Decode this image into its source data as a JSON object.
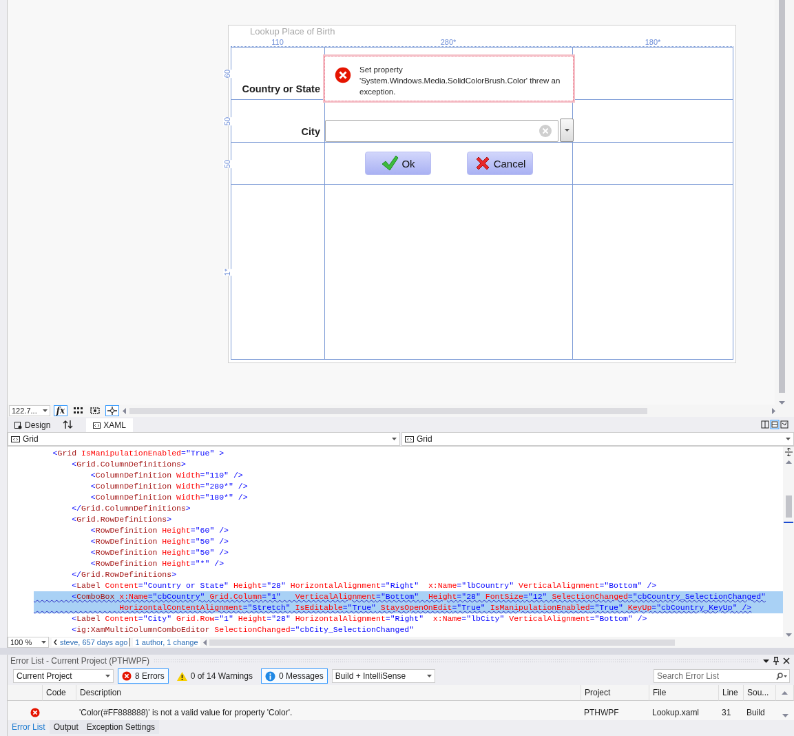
{
  "designer": {
    "window": {
      "title": "Lookup Place of Birth"
    },
    "columns": [
      {
        "label": "110"
      },
      {
        "label": "280*"
      },
      {
        "label": "180*"
      }
    ],
    "rows": [
      {
        "label": "60"
      },
      {
        "label": "50"
      },
      {
        "label": "50"
      },
      {
        "label": "1*"
      }
    ],
    "error_popup": {
      "text": "Set property 'System.Windows.Media.SolidColorBrush.Color' threw an exception."
    },
    "country_label": "Country or State",
    "city_label": "City",
    "buttons": [
      {
        "label": "Ok",
        "kind": "ok"
      },
      {
        "label": "Cancel",
        "kind": "cancel"
      }
    ]
  },
  "designer_toolbar": {
    "zoom": "122.7...",
    "buttons": [
      {
        "kind": "formula",
        "label": "fx",
        "selected": true
      },
      {
        "kind": "grid",
        "selected": false
      },
      {
        "kind": "effects",
        "selected": false
      },
      {
        "kind": "snap",
        "selected": true
      }
    ]
  },
  "view_tabs": [
    {
      "label": "Design",
      "selected": false
    },
    {
      "label": "XAML",
      "selected": true
    }
  ],
  "breadcrumbs": [
    {
      "label": "Grid"
    },
    {
      "label": "Grid"
    }
  ],
  "editor": {
    "lines": [
      {
        "text": "    <Grid IsManipulationEnabled=\"True\" >",
        "selected": false,
        "error": false
      },
      {
        "text": "        <Grid.ColumnDefinitions>",
        "selected": false,
        "error": false
      },
      {
        "text": "            <ColumnDefinition Width=\"110\" />",
        "selected": false,
        "error": false
      },
      {
        "text": "            <ColumnDefinition Width=\"280*\" />",
        "selected": false,
        "error": false
      },
      {
        "text": "            <ColumnDefinition Width=\"180*\" />",
        "selected": false,
        "error": false
      },
      {
        "text": "        </Grid.ColumnDefinitions>",
        "selected": false,
        "error": false
      },
      {
        "text": "        <Grid.RowDefinitions>",
        "selected": false,
        "error": false
      },
      {
        "text": "            <RowDefinition Height=\"60\" />",
        "selected": false,
        "error": false
      },
      {
        "text": "            <RowDefinition Height=\"50\" />",
        "selected": false,
        "error": false
      },
      {
        "text": "            <RowDefinition Height=\"50\" />",
        "selected": false,
        "error": false
      },
      {
        "text": "            <RowDefinition Height=\"*\" />",
        "selected": false,
        "error": false
      },
      {
        "text": "        </Grid.RowDefinitions>",
        "selected": false,
        "error": false
      },
      {
        "text": "        <Label Content=\"Country or State\" Height=\"28\" HorizontalAlignment=\"Right\"  x:Name=\"lbCountry\" VerticalAlignment=\"Bottom\" />",
        "selected": false,
        "error": false
      },
      {
        "text": "        <ComboBox x:Name=\"cbCountry\" Grid.Column=\"1\"   VerticalAlignment=\"Bottom\"  Height=\"28\" FontSize=\"12\" SelectionChanged=\"cbCountry_SelectionChanged\"",
        "selected": true,
        "error": true
      },
      {
        "text": "                  HorizontalContentAlignment=\"Stretch\" IsEditable=\"True\" StaysOpenOnEdit=\"True\" IsManipulationEnabled=\"True\" KeyUp=\"cbCountry_KeyUp\" />",
        "selected": true,
        "error": true
      },
      {
        "text": "        <Label Content=\"City\" Grid.Row=\"1\" Height=\"28\" HorizontalAlignment=\"Right\"  x:Name=\"lbCity\" VerticalAlignment=\"Bottom\" />",
        "selected": false,
        "error": false
      },
      {
        "text": "        <ig:XamMultiColumnComboEditor SelectionChanged=\"cbCity_SelectionChanged\"",
        "selected": false,
        "error": false
      }
    ]
  },
  "editor_status": {
    "zoom": "100 %",
    "blame": "steve, 657 days ago",
    "authors": "1 author, 1 change"
  },
  "error_list": {
    "title": "Error List - Current Project (PTHWPF)",
    "scope": "Current Project",
    "filters": [
      {
        "kind": "error",
        "label": "8 Errors",
        "selected": true
      },
      {
        "kind": "warning",
        "label": "0 of 14 Warnings",
        "selected": false
      },
      {
        "kind": "info",
        "label": "0 Messages",
        "selected": true
      }
    ],
    "source": "Build + IntelliSense",
    "search": {
      "placeholder": "Search Error List"
    },
    "columns": [
      "Code",
      "Description",
      "Project",
      "File",
      "Line",
      "Sou..."
    ],
    "rows": [
      {
        "kind": "error",
        "description": "'Color(#FF888888)' is not a valid value for property 'Color'.",
        "project": "PTHWPF",
        "file": "Lookup.xaml",
        "line": "31",
        "source": "Build"
      }
    ]
  },
  "bottom_tabs": [
    {
      "label": "Error List",
      "selected": true
    },
    {
      "label": "Output",
      "selected": false
    },
    {
      "label": "Exception Settings",
      "selected": false
    }
  ]
}
